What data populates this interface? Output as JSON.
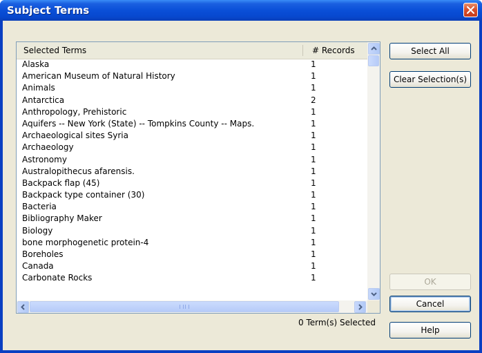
{
  "window": {
    "title": "Subject Terms"
  },
  "list": {
    "headers": {
      "terms": "Selected Terms",
      "records": "# Records"
    },
    "rows": [
      {
        "term": "Alaska",
        "count": "1"
      },
      {
        "term": "American Museum of Natural History",
        "count": "1"
      },
      {
        "term": "Animals",
        "count": "1"
      },
      {
        "term": "Antarctica",
        "count": "2"
      },
      {
        "term": "Anthropology, Prehistoric",
        "count": "1"
      },
      {
        "term": "Aquifers -- New York (State) -- Tompkins County -- Maps.",
        "count": "1"
      },
      {
        "term": "Archaeological sites Syria",
        "count": "1"
      },
      {
        "term": "Archaeology",
        "count": "1"
      },
      {
        "term": "Astronomy",
        "count": "1"
      },
      {
        "term": "Australopithecus afarensis.",
        "count": "1"
      },
      {
        "term": "Backpack flap (45)",
        "count": "1"
      },
      {
        "term": "Backpack type container (30)",
        "count": "1"
      },
      {
        "term": "Bacteria",
        "count": "1"
      },
      {
        "term": "Bibliography Maker",
        "count": "1"
      },
      {
        "term": "Biology",
        "count": "1"
      },
      {
        "term": "bone morphogenetic protein-4",
        "count": "1"
      },
      {
        "term": "Boreholes",
        "count": "1"
      },
      {
        "term": "Canada",
        "count": "1"
      },
      {
        "term": "Carbonate Rocks",
        "count": "1"
      }
    ]
  },
  "status": "0 Term(s) Selected",
  "buttons": {
    "select_all": "Select All",
    "clear_selection": "Clear Selection(s)",
    "ok": "OK",
    "cancel": "Cancel",
    "help": "Help"
  },
  "icons": {
    "close": "close-icon",
    "scroll_up": "scroll-up-arrow-icon",
    "scroll_down": "scroll-down-arrow-icon",
    "scroll_left": "scroll-left-arrow-icon",
    "scroll_right": "scroll-right-arrow-icon"
  },
  "colors": {
    "titlebar": "#0a4fd8",
    "dialog_bg": "#ece9d8",
    "close_button": "#d9502c",
    "button_border": "#003c74"
  }
}
